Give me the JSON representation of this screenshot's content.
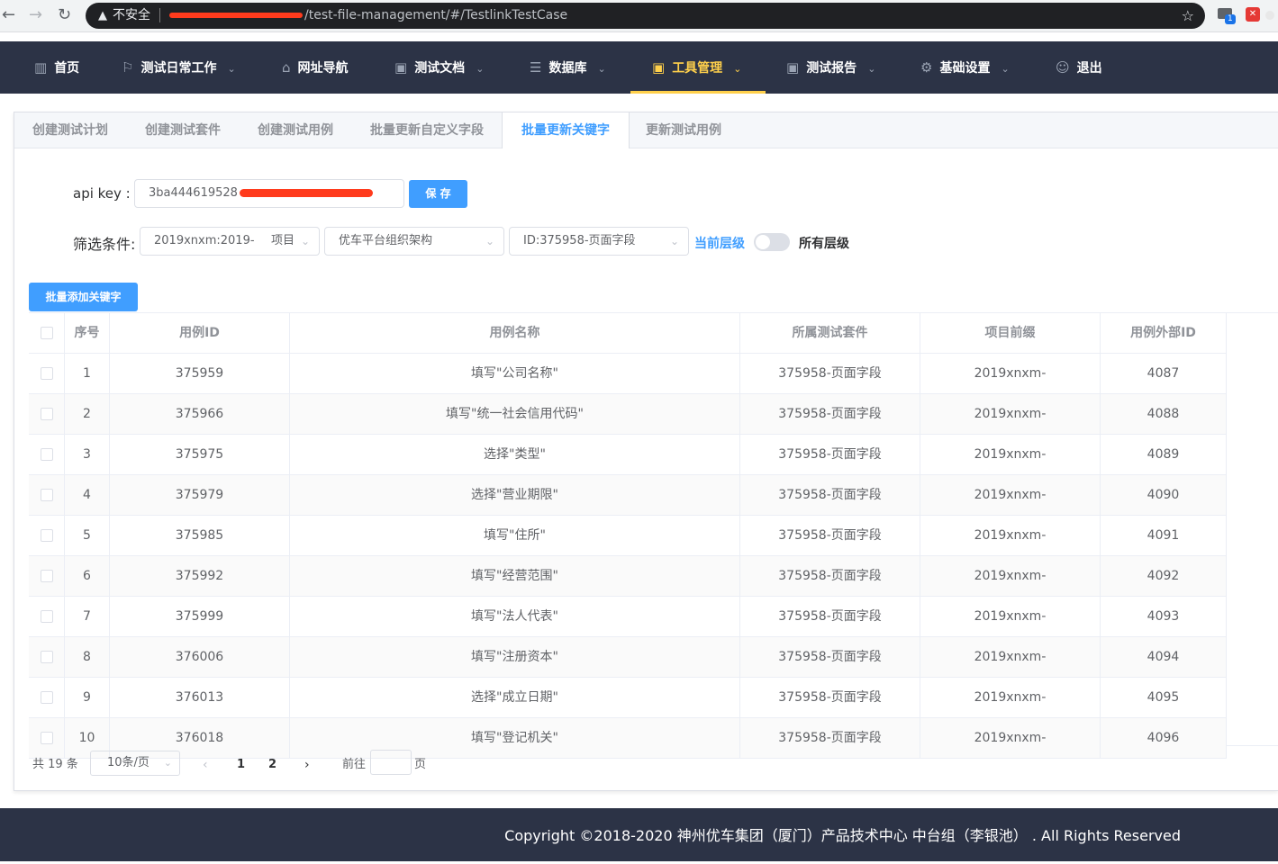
{
  "browser": {
    "insecure_label": "不安全",
    "url_path": "/test-file-management/#/TestlinkTestCase",
    "ext_badge": "1"
  },
  "nav": {
    "items": [
      {
        "label": "首页",
        "icon": "chart-icon"
      },
      {
        "label": "测试日常工作",
        "icon": "run-icon"
      },
      {
        "label": "网址导航",
        "icon": "building-icon"
      },
      {
        "label": "测试文档",
        "icon": "doc-icon"
      },
      {
        "label": "数据库",
        "icon": "database-icon"
      },
      {
        "label": "工具管理",
        "icon": "tool-icon",
        "active": true
      },
      {
        "label": "测试报告",
        "icon": "report-icon"
      },
      {
        "label": "基础设置",
        "icon": "settings-icon"
      },
      {
        "label": "退出",
        "icon": "user-icon"
      }
    ]
  },
  "tabs": [
    "创建测试计划",
    "创建测试套件",
    "创建测试用例",
    "批量更新自定义字段",
    "批量更新关键字",
    "更新测试用例"
  ],
  "form": {
    "api_label": "api key :",
    "api_value": "3ba444619528",
    "save_button": "保 存",
    "filter_label": "筛选条件:",
    "filter1_value": "2019xnxm:2019-",
    "filter1_suffix": "项目",
    "filter2_value": "优车平台组织架构",
    "filter3_value": "ID:375958-页面字段",
    "current_level": "当前层级",
    "all_levels": "所有层级",
    "batch_add_button": "批量添加关键字"
  },
  "table": {
    "headers": [
      "序号",
      "用例ID",
      "用例名称",
      "所属测试套件",
      "项目前缀",
      "用例外部ID"
    ],
    "rows": [
      [
        "1",
        "375959",
        "填写\"公司名称\"",
        "375958-页面字段",
        "2019xnxm-",
        "4087"
      ],
      [
        "2",
        "375966",
        "填写\"统一社会信用代码\"",
        "375958-页面字段",
        "2019xnxm-",
        "4088"
      ],
      [
        "3",
        "375975",
        "选择\"类型\"",
        "375958-页面字段",
        "2019xnxm-",
        "4089"
      ],
      [
        "4",
        "375979",
        "选择\"营业期限\"",
        "375958-页面字段",
        "2019xnxm-",
        "4090"
      ],
      [
        "5",
        "375985",
        "填写\"住所\"",
        "375958-页面字段",
        "2019xnxm-",
        "4091"
      ],
      [
        "6",
        "375992",
        "填写\"经营范围\"",
        "375958-页面字段",
        "2019xnxm-",
        "4092"
      ],
      [
        "7",
        "375999",
        "填写\"法人代表\"",
        "375958-页面字段",
        "2019xnxm-",
        "4093"
      ],
      [
        "8",
        "376006",
        "填写\"注册资本\"",
        "375958-页面字段",
        "2019xnxm-",
        "4094"
      ],
      [
        "9",
        "376013",
        "选择\"成立日期\"",
        "375958-页面字段",
        "2019xnxm-",
        "4095"
      ],
      [
        "10",
        "376018",
        "填写\"登记机关\"",
        "375958-页面字段",
        "2019xnxm-",
        "4096"
      ]
    ]
  },
  "pagination": {
    "total": "共 19 条",
    "page_size": "10条/页",
    "pages": [
      "1",
      "2"
    ],
    "goto_label": "前往",
    "page_suffix": "页"
  },
  "footer": {
    "copyright": "Copyright ©2018-2020 神州优车集团（厦门）产品技术中心 中台组（李银池） . All Rights Reserved"
  },
  "colors": {
    "nav_bg": "#2c3346",
    "active": "#ffd04b",
    "primary": "#409eff"
  }
}
